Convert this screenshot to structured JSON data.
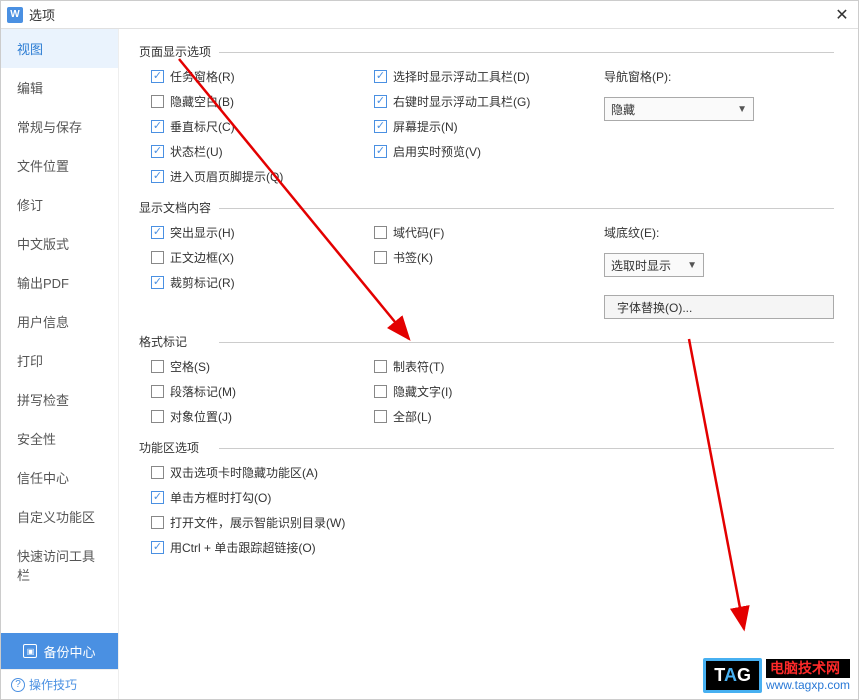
{
  "window": {
    "title": "选项",
    "app_icon_text": "W"
  },
  "sidebar": {
    "items": [
      {
        "label": "视图",
        "active": true
      },
      {
        "label": "编辑"
      },
      {
        "label": "常规与保存"
      },
      {
        "label": "文件位置"
      },
      {
        "label": "修订"
      },
      {
        "label": "中文版式"
      },
      {
        "label": "输出PDF"
      },
      {
        "label": "用户信息"
      },
      {
        "label": "打印"
      },
      {
        "label": "拼写检查"
      },
      {
        "label": "安全性"
      },
      {
        "label": "信任中心"
      },
      {
        "label": "自定义功能区"
      },
      {
        "label": "快速访问工具栏"
      }
    ],
    "backup_label": "备份中心",
    "tips_label": "操作技巧"
  },
  "sections": {
    "page_display": {
      "title": "页面显示选项",
      "col1": [
        {
          "label": "任务窗格(R)",
          "checked": true
        },
        {
          "label": "隐藏空白(B)",
          "checked": false
        },
        {
          "label": "垂直标尺(C)",
          "checked": true
        },
        {
          "label": "状态栏(U)",
          "checked": true
        },
        {
          "label": "进入页眉页脚提示(Q)",
          "checked": true
        }
      ],
      "col2": [
        {
          "label": "选择时显示浮动工具栏(D)",
          "checked": true
        },
        {
          "label": "右键时显示浮动工具栏(G)",
          "checked": true
        },
        {
          "label": "屏幕提示(N)",
          "checked": true
        },
        {
          "label": "启用实时预览(V)",
          "checked": true
        }
      ],
      "nav_label": "导航窗格(P):",
      "nav_value": "隐藏"
    },
    "doc_content": {
      "title": "显示文档内容",
      "col1": [
        {
          "label": "突出显示(H)",
          "checked": true
        },
        {
          "label": "正文边框(X)",
          "checked": false
        },
        {
          "label": "裁剪标记(R)",
          "checked": true
        }
      ],
      "col2": [
        {
          "label": "域代码(F)",
          "checked": false
        },
        {
          "label": "书签(K)",
          "checked": false
        }
      ],
      "shading_label": "域底纹(E):",
      "shading_value": "选取时显示",
      "font_replace_btn": "字体替换(O)..."
    },
    "format_marks": {
      "title": "格式标记",
      "col1": [
        {
          "label": "空格(S)",
          "checked": false
        },
        {
          "label": "段落标记(M)",
          "checked": false
        },
        {
          "label": "对象位置(J)",
          "checked": false
        }
      ],
      "col2": [
        {
          "label": "制表符(T)",
          "checked": false
        },
        {
          "label": "隐藏文字(I)",
          "checked": false
        },
        {
          "label": "全部(L)",
          "checked": false
        }
      ]
    },
    "ribbon": {
      "title": "功能区选项",
      "items": [
        {
          "label": "双击选项卡时隐藏功能区(A)",
          "checked": false
        },
        {
          "label": "单击方框时打勾(O)",
          "checked": true
        },
        {
          "label": "打开文件，展示智能识别目录(W)",
          "checked": false
        },
        {
          "label": "用Ctrl + 单击跟踪超链接(O)",
          "checked": true
        }
      ]
    }
  },
  "watermark": {
    "tag_t": "T",
    "tag_a": "A",
    "tag_g": "G",
    "cn": "电脑技术网",
    "url": "www.tagxp.com"
  }
}
